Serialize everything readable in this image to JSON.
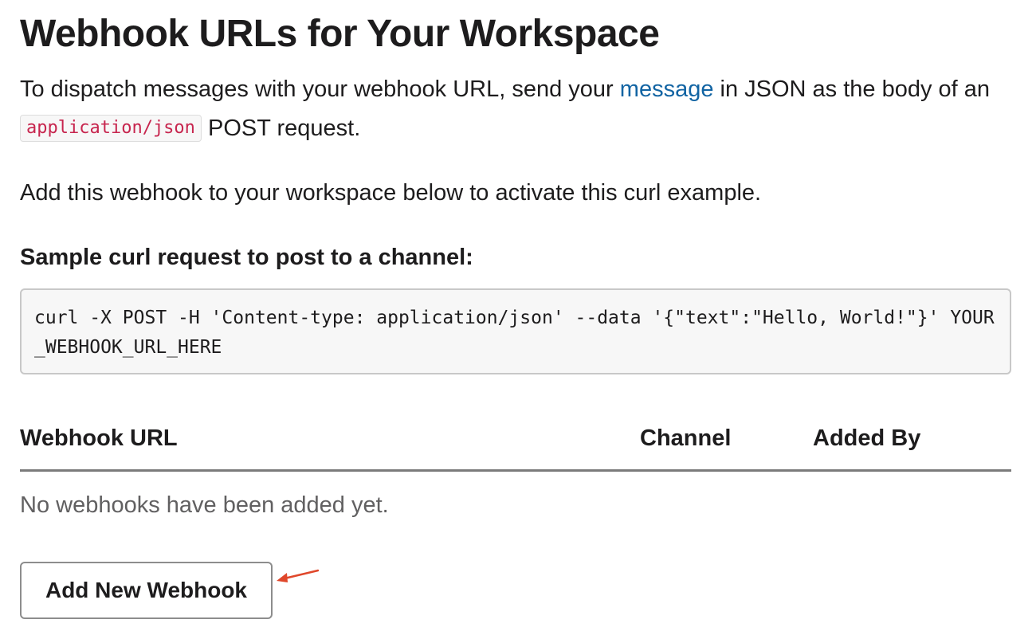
{
  "page": {
    "title": "Webhook URLs for Your Workspace",
    "intro": {
      "part1": "To dispatch messages with your webhook URL, send your ",
      "link_text": "message",
      "part2": " in JSON as the body of an ",
      "code": "application/json",
      "part3": " POST request."
    },
    "activate_text": "Add this webhook to your workspace below to activate this curl example.",
    "sample_heading": "Sample curl request to post to a channel:",
    "curl_command": "curl -X POST -H 'Content-type: application/json' --data '{\"text\":\"Hello, World!\"}' YOUR_WEBHOOK_URL_HERE"
  },
  "table": {
    "columns": [
      "Webhook URL",
      "Channel",
      "Added By"
    ],
    "empty_message": "No webhooks have been added yet."
  },
  "actions": {
    "add_button_label": "Add New Webhook"
  },
  "annotation": {
    "arrow_color": "#e0472b"
  },
  "colors": {
    "link": "#1264a3",
    "inline_code_text": "#c7254e",
    "code_background": "#f7f7f7"
  }
}
